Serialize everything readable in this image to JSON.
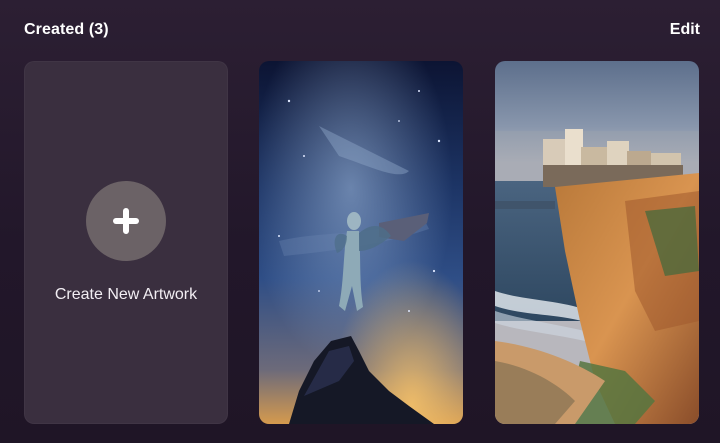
{
  "header": {
    "title": "Created (3)",
    "edit_label": "Edit"
  },
  "create_card": {
    "label": "Create New Artwork",
    "icon": "plus-icon"
  },
  "artworks": [
    {
      "subject": "figure-on-cliff-night-sky",
      "colors": [
        "#0e1636",
        "#3c5a8e",
        "#e2a052"
      ]
    },
    {
      "subject": "coastal-cliff-village",
      "colors": [
        "#5b6e88",
        "#c98a4a",
        "#3f5f3a"
      ]
    }
  ],
  "colors": {
    "background": "#251a2c",
    "card": "#3a2f3f",
    "plus_circle": "#6b6266",
    "text": "#ffffff"
  }
}
